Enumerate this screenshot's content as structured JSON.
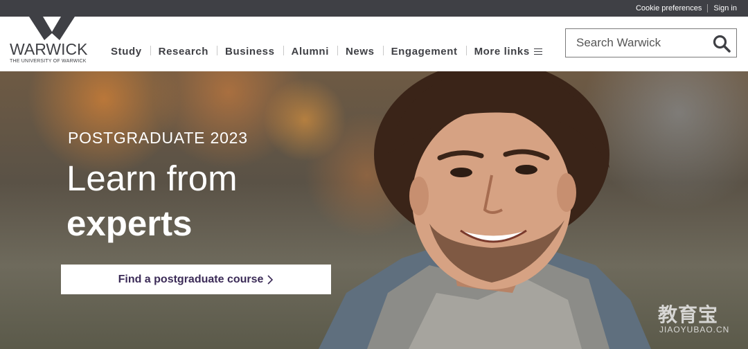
{
  "utility_bar": {
    "cookie_label": "Cookie preferences",
    "signin_label": "Sign in"
  },
  "logo": {
    "wordmark": "WARWICK",
    "subtitle": "THE UNIVERSITY OF WARWICK",
    "icon": "warwick-w-logo"
  },
  "nav": {
    "items": [
      {
        "label": "Study"
      },
      {
        "label": "Research"
      },
      {
        "label": "Business"
      },
      {
        "label": "Alumni"
      },
      {
        "label": "News"
      },
      {
        "label": "Engagement"
      },
      {
        "label": "More links"
      }
    ],
    "more_icon": "hamburger-icon"
  },
  "search": {
    "placeholder": "Search Warwick",
    "icon": "search-icon"
  },
  "hero": {
    "eyebrow": "POSTGRADUATE 2023",
    "title_line1": "Learn from",
    "title_line2": "experts",
    "cta_label": "Find a postgraduate course",
    "cta_icon": "chevron-right-icon",
    "image": "smiling-student-photo"
  },
  "watermark": {
    "cn": "教育宝",
    "en": "JIAOYUBAO.CN"
  },
  "colors": {
    "utility_bar": "#3f4045",
    "nav_text": "#3f4045",
    "cta_text": "#3b2b57"
  }
}
